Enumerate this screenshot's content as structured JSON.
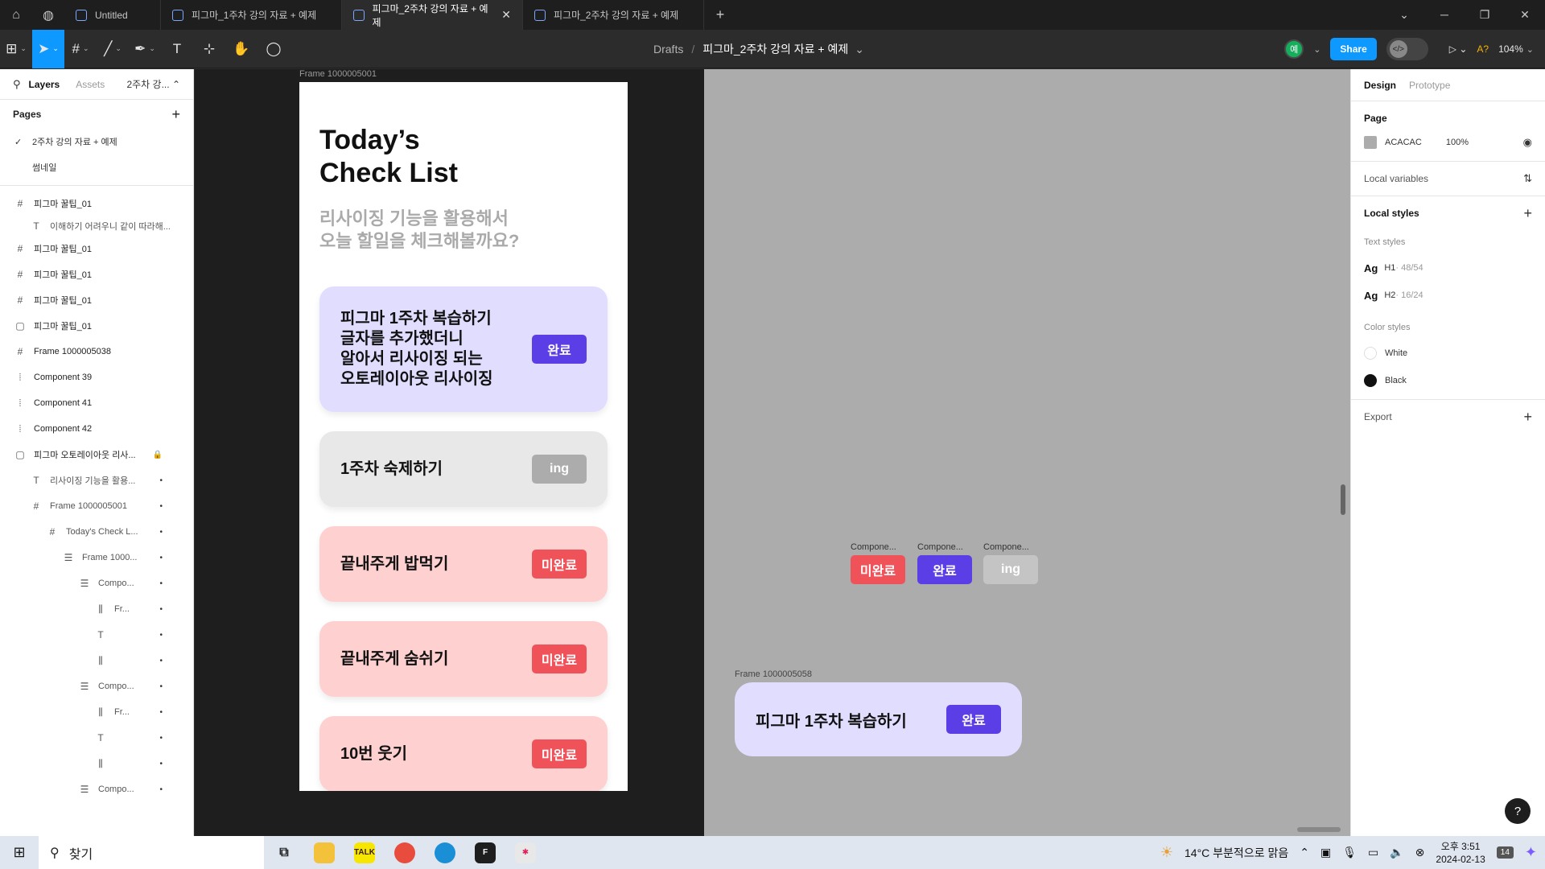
{
  "tabs": [
    {
      "title": "Untitled",
      "active": false
    },
    {
      "title": "피그마_1주차 강의 자료 + 예제",
      "active": false
    },
    {
      "title": "피그마_2주차 강의 자료 + 예제",
      "active": true
    },
    {
      "title": "피그마_2주차 강의 자료 + 예제",
      "active": false
    }
  ],
  "toolbar": {
    "breadcrumb_root": "Drafts",
    "file_name": "피그마_2주차 강의 자료 + 예제",
    "avatar_initial": "예",
    "share_label": "Share",
    "a11y_label": "A?",
    "zoom": "104%"
  },
  "left_panel": {
    "tab_layers": "Layers",
    "tab_assets": "Assets",
    "page_select": "2주차 강...",
    "pages_header": "Pages",
    "pages": [
      {
        "name": "2주차 강의 자료 + 예제",
        "current": true
      },
      {
        "name": "썸네일",
        "current": false
      }
    ],
    "layers": [
      {
        "name": "피그마 꿀팁_01",
        "icon": "frame-icon",
        "indent": 0
      },
      {
        "name": "이해하기 어려우니 같이 따라해...",
        "icon": "text-icon",
        "indent": 1
      },
      {
        "name": "피그마 꿀팁_01",
        "icon": "frame-icon",
        "indent": 0
      },
      {
        "name": "피그마 꿀팁_01",
        "icon": "frame-icon",
        "indent": 0
      },
      {
        "name": "피그마 꿀팁_01",
        "icon": "frame-icon",
        "indent": 0
      },
      {
        "name": "피그마 꿀팁_01",
        "icon": "section-icon",
        "indent": 0
      },
      {
        "name": "Frame 1000005038",
        "icon": "frame-icon",
        "indent": 0
      },
      {
        "name": "Component 39",
        "icon": "component-set-icon",
        "indent": 0
      },
      {
        "name": "Component 41",
        "icon": "component-set-icon",
        "indent": 0
      },
      {
        "name": "Component 42",
        "icon": "component-set-icon",
        "indent": 0
      },
      {
        "name": "피그마 오토레이아웃 리사...",
        "icon": "section-icon",
        "indent": 0,
        "locked": true
      },
      {
        "name": "리사이징 기능을 활용...",
        "icon": "text-icon",
        "indent": 1
      },
      {
        "name": "Frame 1000005001",
        "icon": "frame-icon",
        "indent": 1
      },
      {
        "name": "Today's Check L...",
        "icon": "frame-icon",
        "indent": 2
      },
      {
        "name": "Frame 1000...",
        "icon": "autolayout-v-icon",
        "indent": 3
      },
      {
        "name": "Compo...",
        "icon": "autolayout-v-icon",
        "indent": 4
      },
      {
        "name": "Fr...",
        "icon": "autolayout-h-icon",
        "indent": 5
      },
      {
        "name": "",
        "icon": "text-icon",
        "indent": 5
      },
      {
        "name": "",
        "icon": "autolayout-h-icon",
        "indent": 5
      },
      {
        "name": "Compo...",
        "icon": "autolayout-v-icon",
        "indent": 4
      },
      {
        "name": "Fr...",
        "icon": "autolayout-h-icon",
        "indent": 5
      },
      {
        "name": "",
        "icon": "text-icon",
        "indent": 5
      },
      {
        "name": "",
        "icon": "autolayout-h-icon",
        "indent": 5
      },
      {
        "name": "Compo...",
        "icon": "autolayout-v-icon",
        "indent": 4
      }
    ]
  },
  "canvas": {
    "phone_frame_label": "Frame 1000005001",
    "title": "Today’s\nCheck List",
    "subtitle": "리사이징 기능을 활용해서\n오늘 할일을 체크해볼까요?",
    "cards": [
      {
        "text": "피그마 1주차 복습하기\n글자를 추가했더니\n알아서 리사이징 되는\n오토레이아웃 리사이징",
        "badge": "완료",
        "status": "done"
      },
      {
        "text": "1주차 숙제하기",
        "badge": "ing",
        "status": "ing"
      },
      {
        "text": "끝내주게 밥먹기",
        "badge": "미완료",
        "status": "todo"
      },
      {
        "text": "끝내주게 숨쉬기",
        "badge": "미완료",
        "status": "todo"
      },
      {
        "text": "10번 웃기",
        "badge": "미완료",
        "status": "todo"
      }
    ],
    "components": [
      {
        "label": "Compone...",
        "badge": "미완료",
        "status": "todo"
      },
      {
        "label": "Compone...",
        "badge": "완료",
        "status": "done"
      },
      {
        "label": "Compone...",
        "badge": "ing",
        "status": "ing"
      }
    ],
    "frame2_label": "Frame 1000005058",
    "frame2_card": {
      "text": "피그마 1주차 복습하기",
      "badge": "완료"
    }
  },
  "right_panel": {
    "tab_design": "Design",
    "tab_prototype": "Prototype",
    "page_header": "Page",
    "page_color": "ACACAC",
    "page_opacity": "100%",
    "local_variables": "Local variables",
    "local_styles": "Local styles",
    "text_styles_header": "Text styles",
    "text_styles": [
      {
        "sample": "Ag",
        "name": "H1",
        "meta": " · 48/54"
      },
      {
        "sample": "Ag",
        "name": "H2",
        "meta": " · 16/24"
      }
    ],
    "color_styles_header": "Color styles",
    "color_styles": [
      {
        "name": "White",
        "color": "#ffffff"
      },
      {
        "name": "Black",
        "color": "#111111"
      }
    ],
    "export_header": "Export",
    "help": "?"
  },
  "taskbar": {
    "search_placeholder": "찾기",
    "weather": "14°C  부분적으로 맑음",
    "time": "오후 3:51",
    "date": "2024-02-13",
    "notifications": "14"
  },
  "colors": {
    "accent": "#0d99ff",
    "done": "#5b3ee6",
    "ing": "#acacac",
    "todo": "#f0525a",
    "card_purple": "#e1ddff",
    "card_grey": "#e8e8e8",
    "card_pink": "#ffd0d0",
    "canvas_bg": "#acacac"
  }
}
